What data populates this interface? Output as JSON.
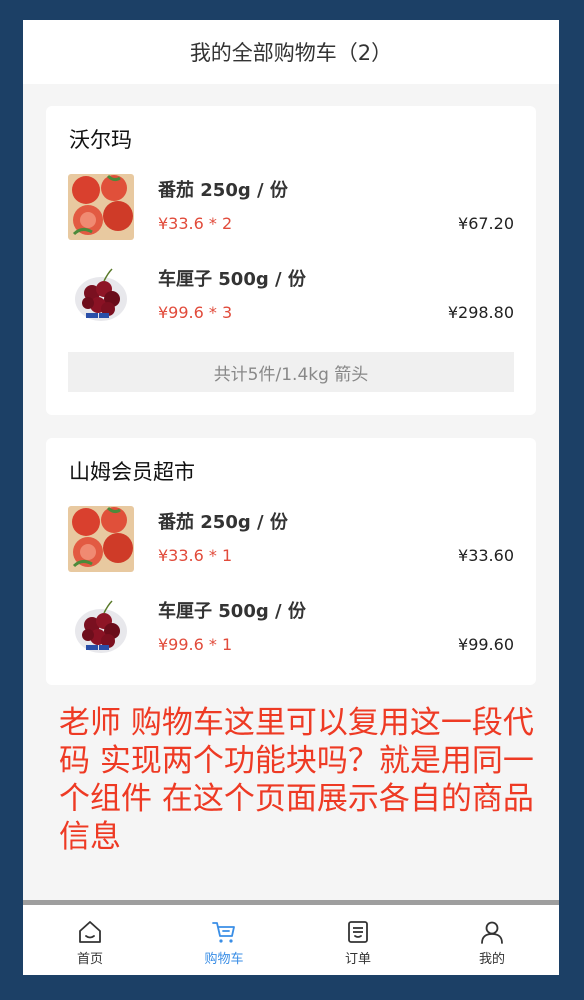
{
  "header": {
    "title": "我的全部购物车（2）"
  },
  "stores": [
    {
      "name": "沃尔玛",
      "items": [
        {
          "name": "番茄 250g / 份",
          "price_qty": "¥33.6 * 2",
          "total": "¥67.20",
          "image": "tomato"
        },
        {
          "name": "车厘子 500g / 份",
          "price_qty": "¥99.6 * 3",
          "total": "¥298.80",
          "image": "cherry"
        }
      ],
      "summary": "共计5件/1.4kg 箭头"
    },
    {
      "name": "山姆会员超市",
      "items": [
        {
          "name": "番茄 250g / 份",
          "price_qty": "¥33.6 * 1",
          "total": "¥33.60",
          "image": "tomato"
        },
        {
          "name": "车厘子 500g / 份",
          "price_qty": "¥99.6 * 1",
          "total": "¥99.60",
          "image": "cherry"
        }
      ]
    }
  ],
  "note": "老师 购物车这里可以复用这一段代码 实现两个功能块吗？就是用同一个组件 在这个页面展示各自的商品信息",
  "tabbar": [
    {
      "label": "首页",
      "icon": "home-icon",
      "active": false
    },
    {
      "label": "购物车",
      "icon": "cart-icon",
      "active": true
    },
    {
      "label": "订单",
      "icon": "order-icon",
      "active": false
    },
    {
      "label": "我的",
      "icon": "user-icon",
      "active": false
    }
  ],
  "colors": {
    "background": "#1c4066",
    "accent": "#3a8ee6",
    "price": "#e14b3b",
    "note": "#ee3a24"
  }
}
